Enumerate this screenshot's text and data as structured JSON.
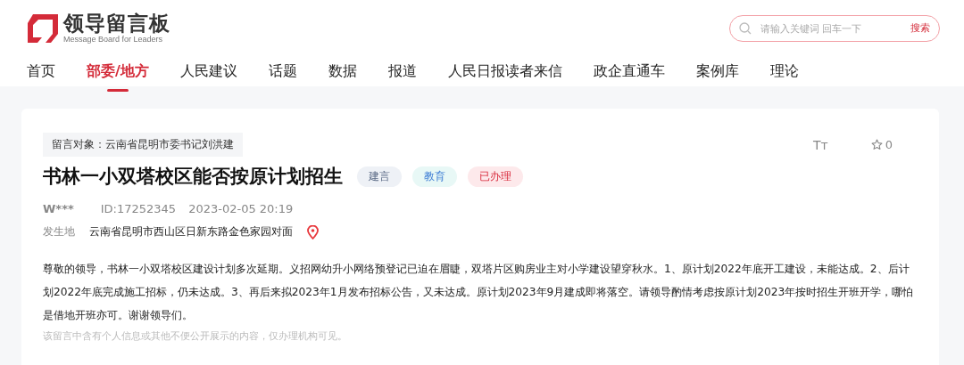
{
  "logo": {
    "title": "领导留言板",
    "subtitle": "Message Board for Leaders"
  },
  "search": {
    "placeholder": "请输入关键词 回车一下",
    "button": "搜索"
  },
  "nav": [
    {
      "label": "首页",
      "selected": false
    },
    {
      "label": "部委/地方",
      "selected": true
    },
    {
      "label": "人民建议",
      "selected": false
    },
    {
      "label": "话题",
      "selected": false
    },
    {
      "label": "数据",
      "selected": false
    },
    {
      "label": "报道",
      "selected": false
    },
    {
      "label": "人民日报读者来信",
      "selected": false
    },
    {
      "label": "政企直通车",
      "selected": false
    },
    {
      "label": "案例库",
      "selected": false
    },
    {
      "label": "理论",
      "selected": false
    }
  ],
  "message": {
    "recipient": "留言对象：云南省昆明市委书记刘洪建",
    "font_size_label": "Tт",
    "favorites": "0",
    "title": "书林一小双塔校区能否按原计划招生",
    "tags": [
      {
        "label": "建言",
        "kind": "type"
      },
      {
        "label": "教育",
        "kind": "field"
      },
      {
        "label": "已办理",
        "kind": "status"
      }
    ],
    "author": "W***",
    "id": "ID:17252345",
    "time": "2023-02-05 20:19",
    "location_label": "发生地",
    "location": "云南省昆明市西山区日新东路金色家园对面",
    "body": "尊敬的领导，书林一小双塔校区建设计划多次延期。义招网幼升小网络预登记已迫在眉睫，双塔片区购房业主对小学建设望穿秋水。1、原计划2022年底开工建设，未能达成。2、后计划2022年底完成施工招标，仍未达成。3、再后来拟2023年1月发布招标公告，又未达成。原计划2023年9月建成即将落空。请领导酌情考虑按原计划2023年按时招生开班开学，哪怕是借地开班亦可。谢谢领导们。",
    "note": "该留言中含有个人信息或其他不便公开展示的内容，仅办理机构可见。"
  }
}
